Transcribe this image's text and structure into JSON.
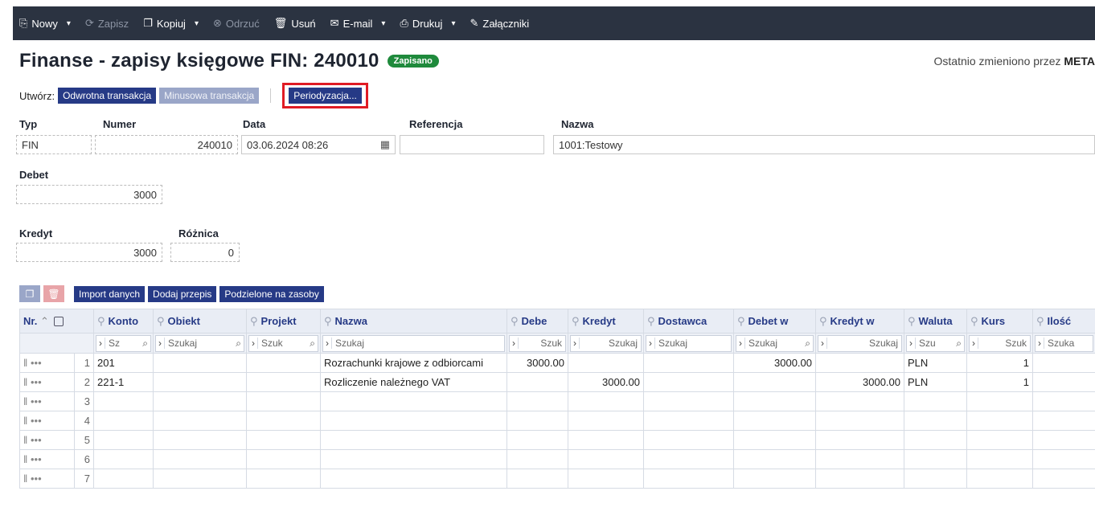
{
  "toolbar": {
    "items": [
      {
        "icon": "new-icon",
        "glyph": "⎘",
        "label": "Nowy",
        "caret": true,
        "disabled": false
      },
      {
        "icon": "save-icon",
        "glyph": "⟳",
        "label": "Zapisz",
        "caret": false,
        "disabled": true
      },
      {
        "icon": "copy-icon",
        "glyph": "❐",
        "label": "Kopiuj",
        "caret": true,
        "disabled": false
      },
      {
        "icon": "discard-icon",
        "glyph": "⊗",
        "label": "Odrzuć",
        "caret": false,
        "disabled": true
      },
      {
        "icon": "trash-icon",
        "glyph": "🗑",
        "label": "Usuń",
        "caret": false,
        "disabled": false
      },
      {
        "icon": "email-icon",
        "glyph": "✉",
        "label": "E-mail",
        "caret": true,
        "disabled": false
      },
      {
        "icon": "print-icon",
        "glyph": "⎙",
        "label": "Drukuj",
        "caret": true,
        "disabled": false
      },
      {
        "icon": "paperclip-icon",
        "glyph": "✎",
        "label": "Załączniki",
        "caret": false,
        "disabled": false
      }
    ]
  },
  "header": {
    "title": "Finanse - zapisy księgowe FIN: 240010",
    "status": "Zapisano",
    "last_modified_prefix": "Ostatnio zmieniono przez",
    "last_modified_user": "META"
  },
  "create": {
    "label": "Utwórz:",
    "reverse": "Odwrotna transakcja",
    "minus": "Minusowa transakcja",
    "accrual": "Periodyzacja..."
  },
  "form": {
    "typ_label": "Typ",
    "typ_value": "FIN",
    "numer_label": "Numer",
    "numer_value": "240010",
    "data_label": "Data",
    "data_value": "03.06.2024 08:26",
    "ref_label": "Referencja",
    "ref_value": "",
    "nazwa_label": "Nazwa",
    "nazwa_value": "1001:Testowy",
    "debet_label": "Debet",
    "debet_value": "3000",
    "kredyt_label": "Kredyt",
    "kredyt_value": "3000",
    "roznica_label": "Różnica",
    "roznica_value": "0"
  },
  "grid_toolbar": {
    "import": "Import danych",
    "add_rule": "Dodaj przepis",
    "split": "Podzielone na zasoby"
  },
  "grid": {
    "columns": [
      "Nr.",
      "Konto",
      "Obiekt",
      "Projekt",
      "Nazwa",
      "Debe",
      "Kredyt",
      "Dostawca",
      "Debet w",
      "Kredyt w",
      "Waluta",
      "Kurs",
      "Ilość"
    ],
    "search": [
      "Sz",
      "Szukaj",
      "Szuk",
      "Szukaj",
      "Szuk",
      "Szukaj",
      "Szukaj",
      "Szukaj",
      "Szukaj",
      "Szu",
      "Szuk",
      "Szuka"
    ],
    "rows": [
      {
        "nr": "1",
        "konto": "201",
        "nazwa": "Rozrachunki krajowe z odbiorcami",
        "debe": "3000.00",
        "kredyt": "",
        "debet_w": "3000.00",
        "kredyt_w": "",
        "waluta": "PLN",
        "kurs": "1"
      },
      {
        "nr": "2",
        "konto": "221-1",
        "nazwa": "Rozliczenie należnego VAT",
        "debe": "",
        "kredyt": "3000.00",
        "debet_w": "",
        "kredyt_w": "3000.00",
        "waluta": "PLN",
        "kurs": "1"
      },
      {
        "nr": "3",
        "konto": "",
        "nazwa": "",
        "debe": "",
        "kredyt": "",
        "debet_w": "",
        "kredyt_w": "",
        "waluta": "",
        "kurs": ""
      },
      {
        "nr": "4",
        "konto": "",
        "nazwa": "",
        "debe": "",
        "kredyt": "",
        "debet_w": "",
        "kredyt_w": "",
        "waluta": "",
        "kurs": ""
      },
      {
        "nr": "5",
        "konto": "",
        "nazwa": "",
        "debe": "",
        "kredyt": "",
        "debet_w": "",
        "kredyt_w": "",
        "waluta": "",
        "kurs": ""
      },
      {
        "nr": "6",
        "konto": "",
        "nazwa": "",
        "debe": "",
        "kredyt": "",
        "debet_w": "",
        "kredyt_w": "",
        "waluta": "",
        "kurs": ""
      },
      {
        "nr": "7",
        "konto": "",
        "nazwa": "",
        "debe": "",
        "kredyt": "",
        "debet_w": "",
        "kredyt_w": "",
        "waluta": "",
        "kurs": ""
      }
    ]
  },
  "colors": {
    "toolbar_bg": "#2b3341",
    "accent": "#263a86",
    "status": "#1f8a3c",
    "highlight": "#e01b24"
  }
}
